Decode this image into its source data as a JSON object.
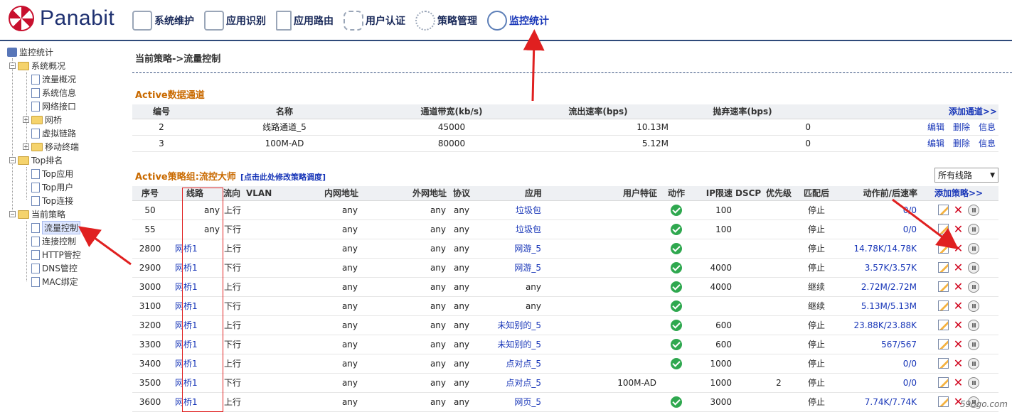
{
  "header": {
    "logo": "Panabit",
    "nav": [
      {
        "label": "系统维护",
        "icon": "server-icon"
      },
      {
        "label": "应用识别",
        "icon": "disk-icon"
      },
      {
        "label": "应用路由",
        "icon": "document-icon"
      },
      {
        "label": "用户认证",
        "icon": "puzzle-icon"
      },
      {
        "label": "策略管理",
        "icon": "gear-icon"
      },
      {
        "label": "监控统计",
        "icon": "globe-icon",
        "active": true
      }
    ]
  },
  "sidebar": {
    "root": "监控统计",
    "groups": [
      {
        "label": "系统概况",
        "items": [
          "流量概况",
          "系统信息",
          "网络接口",
          "网桥",
          "虚拟链路",
          "移动终端"
        ]
      },
      {
        "label": "Top排名",
        "items": [
          "Top应用",
          "Top用户",
          "Top连接"
        ]
      },
      {
        "label": "当前策略",
        "items": [
          "流量控制",
          "连接控制",
          "HTTP管控",
          "DNS管控",
          "MAC绑定"
        ]
      }
    ],
    "selected": "流量控制"
  },
  "main": {
    "breadcrumb": "当前策略->流量控制",
    "channels": {
      "title": "Active数据通道",
      "headers": [
        "编号",
        "名称",
        "通道带宽(kb/s)",
        "流出速率(bps)",
        "抛弃速率(bps)"
      ],
      "add_label": "添加通道>>",
      "rows": [
        {
          "id": "2",
          "name": "线路通道_5",
          "bandwidth": "45000",
          "out_rate": "10.13M",
          "drop_rate": "0"
        },
        {
          "id": "3",
          "name": "100M-AD",
          "bandwidth": "80000",
          "out_rate": "5.12M",
          "drop_rate": "0"
        }
      ],
      "ops": [
        "编辑",
        "删除",
        "信息"
      ]
    },
    "policy": {
      "title": "Active策略组:流控大师",
      "note": "[点击此处修改策略调度]",
      "line_select": "所有线路",
      "headers": [
        "序号",
        "线路",
        "流向",
        "VLAN",
        "内网地址",
        "外网地址",
        "协议",
        "应用",
        "用户特征",
        "动作",
        "IP限速",
        "DSCP",
        "优先级",
        "匹配后",
        "动作前/后速率"
      ],
      "add_label": "添加策略>>",
      "rows": [
        {
          "seq": "50",
          "line": "any",
          "dir": "上行",
          "vlan": "",
          "in": "any",
          "out": "any",
          "proto": "any",
          "app": "垃圾包",
          "user": "",
          "ip_limit": "100",
          "dscp": "",
          "prio": "",
          "after": "停止",
          "rate": "0/0"
        },
        {
          "seq": "55",
          "line": "any",
          "dir": "下行",
          "vlan": "",
          "in": "any",
          "out": "any",
          "proto": "any",
          "app": "垃圾包",
          "user": "",
          "ip_limit": "100",
          "dscp": "",
          "prio": "",
          "after": "停止",
          "rate": "0/0"
        },
        {
          "seq": "2800",
          "line": "网桥1",
          "dir": "上行",
          "vlan": "",
          "in": "any",
          "out": "any",
          "proto": "any",
          "app": "网游_5",
          "user": "",
          "ip_limit": "",
          "dscp": "",
          "prio": "",
          "after": "停止",
          "rate": "14.78K/14.78K"
        },
        {
          "seq": "2900",
          "line": "网桥1",
          "dir": "下行",
          "vlan": "",
          "in": "any",
          "out": "any",
          "proto": "any",
          "app": "网游_5",
          "user": "",
          "ip_limit": "4000",
          "dscp": "",
          "prio": "",
          "after": "停止",
          "rate": "3.57K/3.57K"
        },
        {
          "seq": "3000",
          "line": "网桥1",
          "dir": "上行",
          "vlan": "",
          "in": "any",
          "out": "any",
          "proto": "any",
          "app": "any",
          "user": "",
          "ip_limit": "4000",
          "dscp": "",
          "prio": "",
          "after": "继续",
          "rate": "2.72M/2.72M"
        },
        {
          "seq": "3100",
          "line": "网桥1",
          "dir": "下行",
          "vlan": "",
          "in": "any",
          "out": "any",
          "proto": "any",
          "app": "any",
          "user": "",
          "ip_limit": "",
          "dscp": "",
          "prio": "",
          "after": "继续",
          "rate": "5.13M/5.13M"
        },
        {
          "seq": "3200",
          "line": "网桥1",
          "dir": "上行",
          "vlan": "",
          "in": "any",
          "out": "any",
          "proto": "any",
          "app": "未知别的_5",
          "user": "",
          "ip_limit": "600",
          "dscp": "",
          "prio": "",
          "after": "停止",
          "rate": "23.88K/23.88K"
        },
        {
          "seq": "3300",
          "line": "网桥1",
          "dir": "下行",
          "vlan": "",
          "in": "any",
          "out": "any",
          "proto": "any",
          "app": "未知别的_5",
          "user": "",
          "ip_limit": "600",
          "dscp": "",
          "prio": "",
          "after": "停止",
          "rate": "567/567"
        },
        {
          "seq": "3400",
          "line": "网桥1",
          "dir": "上行",
          "vlan": "",
          "in": "any",
          "out": "any",
          "proto": "any",
          "app": "点对点_5",
          "user": "",
          "ip_limit": "1000",
          "dscp": "",
          "prio": "",
          "after": "停止",
          "rate": "0/0"
        },
        {
          "seq": "3500",
          "line": "网桥1",
          "dir": "下行",
          "vlan": "",
          "in": "any",
          "out": "any",
          "proto": "any",
          "app": "点对点_5",
          "user": "",
          "action_label": "100M-AD",
          "ip_limit": "1000",
          "dscp": "",
          "prio": "2",
          "after": "停止",
          "rate": "0/0"
        },
        {
          "seq": "3600",
          "line": "网桥1",
          "dir": "上行",
          "vlan": "",
          "in": "any",
          "out": "any",
          "proto": "any",
          "app": "网页_5",
          "user": "",
          "ip_limit": "3000",
          "dscp": "",
          "prio": "",
          "after": "停止",
          "rate": "7.74K/7.74K"
        }
      ]
    }
  },
  "watermark": "59ogo.com",
  "colors": {
    "accent": "#1836b8",
    "section": "#c96a00",
    "annotation": "#e02020",
    "ok": "#2fa84f"
  }
}
